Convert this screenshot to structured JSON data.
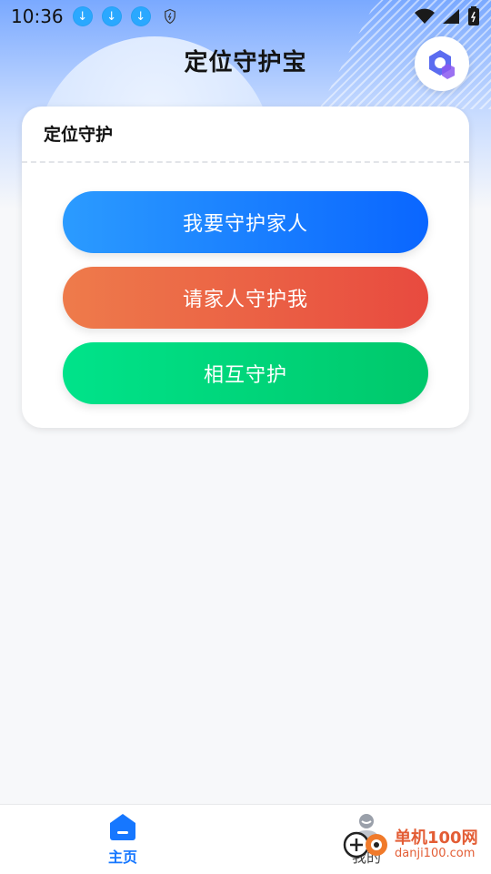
{
  "status_bar": {
    "time": "10:36",
    "icons": [
      "download-icon",
      "download-icon",
      "download-icon",
      "shield-icon",
      "wifi-icon",
      "signal-icon",
      "battery-icon"
    ]
  },
  "header": {
    "title": "定位守护宝",
    "logo_icon": "hexagon-logo-icon"
  },
  "card": {
    "title": "定位守护",
    "buttons": [
      {
        "label": "我要守护家人",
        "color": "#1677ff"
      },
      {
        "label": "请家人守护我",
        "color": "#ea5a44"
      },
      {
        "label": "相互守护",
        "color": "#00d47a"
      }
    ]
  },
  "bottom_nav": {
    "items": [
      {
        "label": "主页",
        "icon": "home-icon",
        "active": true
      },
      {
        "label": "我的",
        "icon": "user-icon",
        "active": false
      }
    ]
  },
  "watermark": {
    "brand": "单机100网",
    "url": "danji100.com"
  }
}
